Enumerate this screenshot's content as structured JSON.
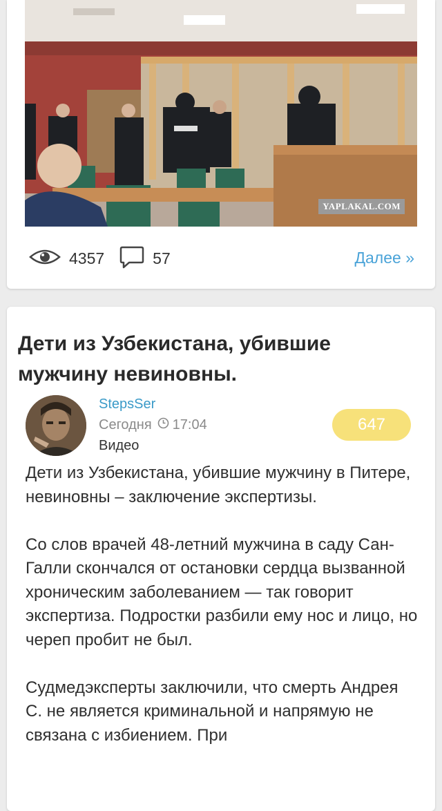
{
  "first_post": {
    "photo": {
      "alt": "",
      "watermark": "YAPLAKAL.COM"
    },
    "stats": {
      "views": "4357",
      "comments": "57",
      "more_label": "Далее »"
    }
  },
  "second_post": {
    "title": "Дети из Узбекистана, убившие мужчину невиновны.",
    "author": "StepsSer",
    "date_label": "Сегодня",
    "time": "17:04",
    "category": "Видео",
    "rating": "647",
    "body": [
      "Дети из Узбекистана, убившие мужчину в Питере, невиновны – заключение экспертизы.",
      "Со слов врачей 48-летний мужчина в саду Сан-Галли скончался от остановки сердца вызванной хроническим заболеванием — так говорит экспертиза. Подростки разбили ему нос и лицо, но череп пробит не был.",
      "Судмедэксперты заключили, что смерть Андрея С. не является криминальной и напрямую не связана с избиением. При"
    ]
  },
  "colors": {
    "link": "#4aa3d8",
    "author": "#3a9ac8",
    "rating_badge": "#f7e17a",
    "background": "#ececec"
  },
  "icons": {
    "views": "eye-icon",
    "comments": "speech-bubble-icon",
    "time": "clock-icon"
  }
}
